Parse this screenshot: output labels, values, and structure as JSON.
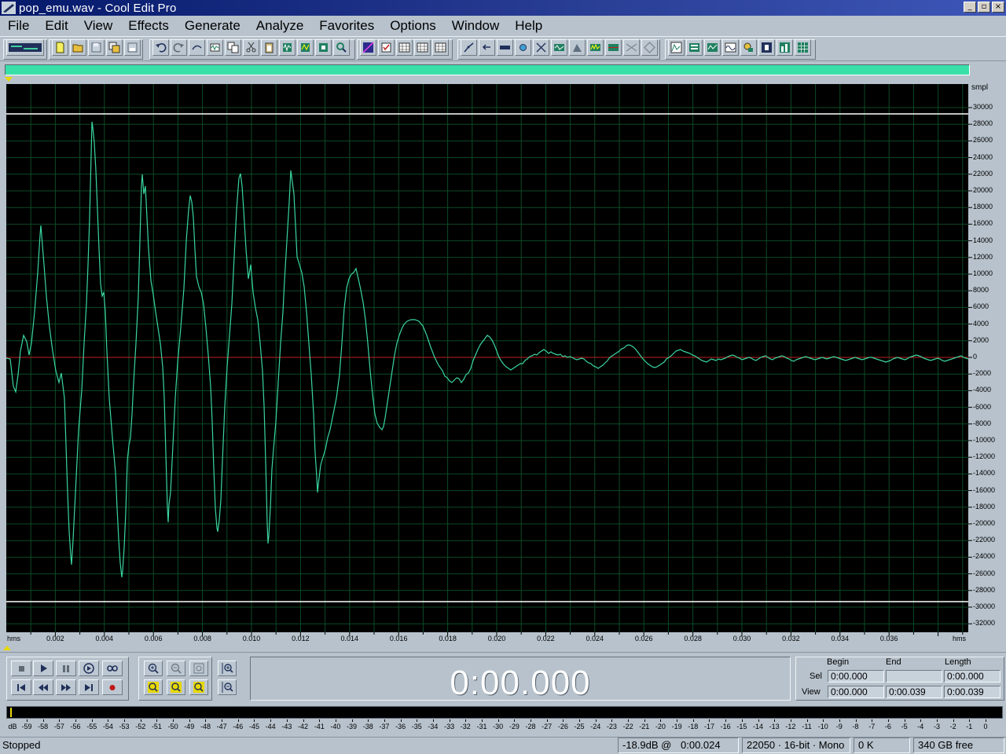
{
  "window": {
    "title": "pop_emu.wav - Cool Edit Pro",
    "buttons": {
      "minimize": "_",
      "maximize": "▫",
      "close": "×"
    }
  },
  "menu": [
    "File",
    "Edit",
    "View",
    "Effects",
    "Generate",
    "Analyze",
    "Favorites",
    "Options",
    "Window",
    "Help"
  ],
  "colors": {
    "waveform": "#3ad6a0",
    "background": "#000000",
    "grid": "#0b4a26",
    "center_line": "#c02020",
    "clip_line": "#ffffff",
    "overview": "#38e0a8",
    "chrome": "#b7c2cc"
  },
  "waveform": {
    "y_unit": "smpl",
    "y_ticks": [
      "30000",
      "28000",
      "26000",
      "24000",
      "22000",
      "20000",
      "18000",
      "16000",
      "14000",
      "12000",
      "10000",
      "8000",
      "6000",
      "4000",
      "2000",
      "0",
      "-2000",
      "-4000",
      "-6000",
      "-8000",
      "-10000",
      "-12000",
      "-14000",
      "-16000",
      "-18000",
      "-20000",
      "-22000",
      "-24000",
      "-26000",
      "-28000",
      "-30000",
      "-32000"
    ],
    "x_unit": "hms",
    "x_ticks": [
      "0.002",
      "0.004",
      "0.006",
      "0.008",
      "0.010",
      "0.012",
      "0.014",
      "0.016",
      "0.018",
      "0.020",
      "0.022",
      "0.024",
      "0.026",
      "0.028",
      "0.030",
      "0.032",
      "0.034",
      "0.036"
    ]
  },
  "transport": {
    "time": "0:00.000"
  },
  "selection": {
    "headers": {
      "begin": "Begin",
      "end": "End",
      "length": "Length"
    },
    "sel_label": "Sel",
    "view_label": "View",
    "sel": {
      "begin": "0:00.000",
      "end": "",
      "length": "0:00.000"
    },
    "view": {
      "begin": "0:00.000",
      "end": "0:00.039",
      "length": "0:00.039"
    }
  },
  "meter": {
    "unit": "dB",
    "ticks": [
      "-59",
      "-58",
      "-57",
      "-56",
      "-55",
      "-54",
      "-53",
      "-52",
      "-51",
      "-50",
      "-49",
      "-48",
      "-47",
      "-46",
      "-45",
      "-44",
      "-43",
      "-42",
      "-41",
      "-40",
      "-39",
      "-38",
      "-37",
      "-36",
      "-35",
      "-34",
      "-33",
      "-32",
      "-31",
      "-30",
      "-29",
      "-28",
      "-27",
      "-26",
      "-25",
      "-24",
      "-23",
      "-22",
      "-21",
      "-20",
      "-19",
      "-18",
      "-17",
      "-16",
      "-15",
      "-14",
      "-13",
      "-12",
      "-11",
      "-10",
      "-9",
      "-8",
      "-7",
      "-6",
      "-5",
      "-4",
      "-3",
      "-2",
      "-1",
      "0"
    ]
  },
  "status": {
    "state": "Stopped",
    "level": "-18.9dB @",
    "level_time": "0:00.024",
    "format": "22050 · 16-bit · Mono",
    "size": "0 K",
    "free": "340 GB free"
  }
}
